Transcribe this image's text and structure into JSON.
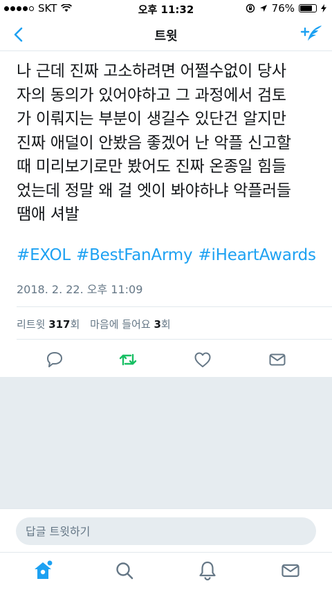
{
  "status_bar": {
    "carrier": "SKT",
    "time": "오후 11:32",
    "battery_percent": "76%",
    "battery_level": 0.76
  },
  "nav": {
    "title": "트윗",
    "back_icon": "chevron-left-icon",
    "compose_icon": "compose-feather-icon"
  },
  "tweet": {
    "lines": [
      "나 근데 진짜 고소하려면 어쩔수없이 당사",
      "자의 동의가 있어야하고 그 과정에서 검토",
      "가 이뤄지는 부분이 생길수 있단건 알지만",
      "진짜 애덜이 안봤음 좋겠어 난 악플 신고할",
      "때 미리보기로만 봤어도 진짜 온종일 힘들",
      "었는데 정말 왜 걸 엣이 봐야하냐 악플러들",
      "땜애 셔발"
    ],
    "hashtags": [
      "#EXOL",
      "#BestFanArmy",
      "#iHeartAwards"
    ],
    "timestamp": "2018. 2. 22. 오후 11:09"
  },
  "stats": {
    "retweet_label": "리트윗",
    "retweet_count": "317",
    "retweet_unit": "회",
    "like_label": "마음에 들어요",
    "like_count": "3",
    "like_unit": "회"
  },
  "actions": {
    "reply_icon": "reply-icon",
    "retweet_icon": "retweet-icon",
    "like_icon": "heart-icon",
    "share_icon": "message-icon",
    "retweet_color": "#17bf63"
  },
  "reply": {
    "placeholder": "답글 트윗하기"
  },
  "tabbar": {
    "items": [
      "home-icon",
      "search-icon",
      "notifications-icon",
      "messages-icon"
    ]
  },
  "colors": {
    "accent": "#1da1f2",
    "text": "#14171a",
    "muted": "#657786",
    "background_gray": "#e6ecf0"
  }
}
